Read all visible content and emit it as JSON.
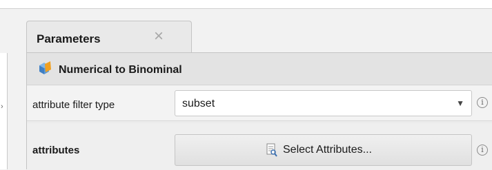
{
  "tab": {
    "label": "Parameters",
    "close_icon": "×"
  },
  "operator": {
    "title": "Numerical to Binominal",
    "icon": "operator-cube-icon"
  },
  "params": [
    {
      "label": "attribute filter type",
      "value": "subset",
      "arrow": "▼",
      "help": "i"
    },
    {
      "label": "attributes",
      "button_label": "Select Attributes...",
      "button_icon": "attribute-selector-icon",
      "help": "i"
    }
  ],
  "left_panel": {
    "collapse_glyph": "›"
  },
  "colors": {
    "accent_orange": "#f0a020",
    "icon_blue": "#4a8fd8",
    "panel_bg": "#ececec"
  }
}
